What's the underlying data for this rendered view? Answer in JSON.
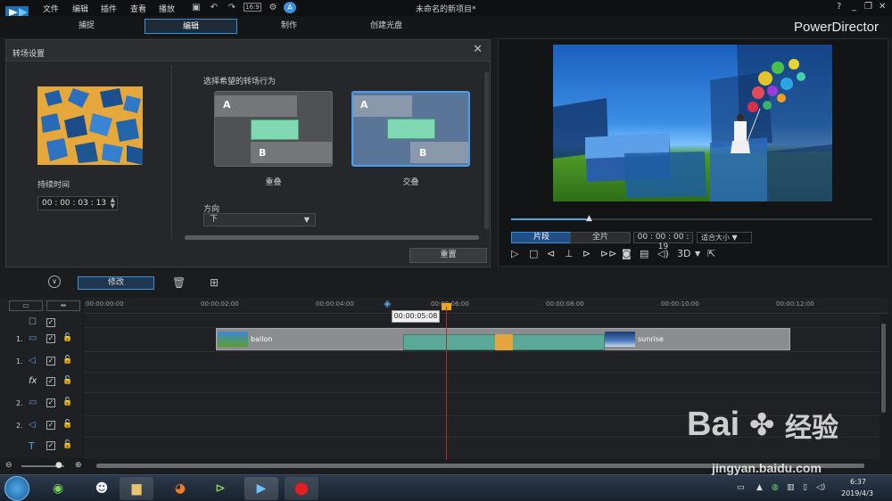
{
  "menu": [
    "文件",
    "编辑",
    "插件",
    "查看",
    "播放"
  ],
  "toolbar": {
    "fit_label": "16:9"
  },
  "document_title": "未命名的新项目*",
  "window_controls": [
    "?",
    "_",
    "❐",
    "✕"
  ],
  "modes": [
    {
      "label": "捕捉",
      "active": false
    },
    {
      "label": "编辑",
      "active": true
    },
    {
      "label": "制作",
      "active": false
    },
    {
      "label": "创建光盘",
      "active": false
    }
  ],
  "brand": "PowerDirector",
  "transition_panel": {
    "title": "转场设置",
    "close": "✕",
    "duration_label": "持续时间",
    "duration_value": "00 : 00 : 03 : 13",
    "behavior_label": "选择希望的转场行为",
    "options": [
      {
        "caption": "重叠",
        "a": "A",
        "b": "B",
        "selected": false
      },
      {
        "caption": "交叠",
        "a": "A",
        "b": "B",
        "selected": true
      }
    ],
    "direction_label": "方向",
    "direction_value": "下",
    "reset_label": "重置"
  },
  "preview": {
    "clip_label": "片段",
    "full_label": "全片",
    "timecode": "00 : 00 : 00 : 19",
    "fit": "适合大小",
    "progress": 0.22,
    "three_d": "3D"
  },
  "timeline": {
    "modify_label": "修改",
    "ruler": [
      "00:00:00:00",
      "00:00:02:00",
      "00:00:04:00",
      "00:00:06:00",
      "00:00:08:00",
      "00:00:10:00",
      "00:00:12:00"
    ],
    "hover_time": "00:00:05:08",
    "tracks": [
      {
        "num": "",
        "icon": "master-icon"
      },
      {
        "num": "1.",
        "icon": "video-track-icon"
      },
      {
        "num": "1.",
        "icon": "audio-track-icon"
      },
      {
        "num": "",
        "icon": "fx-icon",
        "glyph": "fx"
      },
      {
        "num": "2.",
        "icon": "video-track-icon"
      },
      {
        "num": "2.",
        "icon": "audio-track-icon"
      },
      {
        "num": "",
        "icon": "title-icon",
        "glyph": "T"
      }
    ],
    "clips": [
      {
        "name": "ballon"
      },
      {
        "name": "sunrise"
      }
    ]
  },
  "taskbar": {
    "time": "6:37",
    "date": "2019/4/3"
  },
  "watermark": {
    "text": "Bai",
    "cn": "经验",
    "url": "jingyan.baidu.com"
  }
}
